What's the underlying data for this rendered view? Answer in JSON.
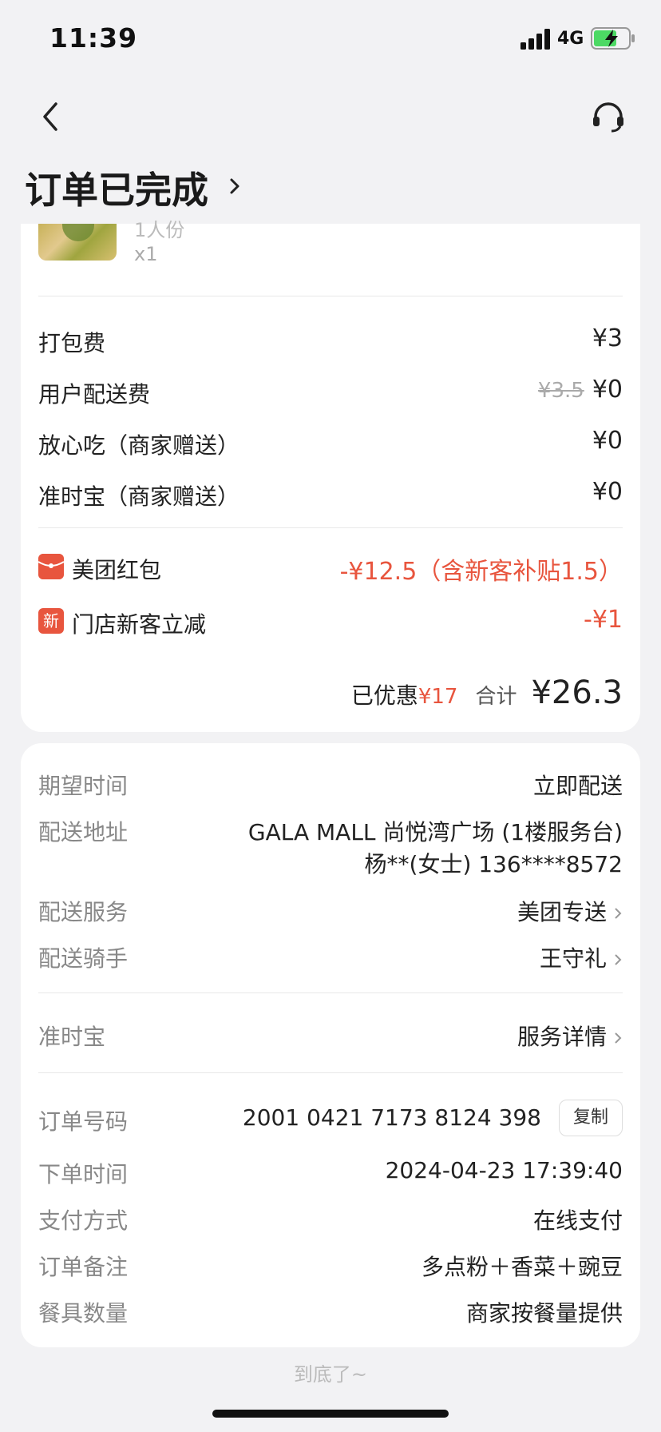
{
  "status": {
    "time": "11:39",
    "network": "4G"
  },
  "nav": {
    "title": "订单已完成"
  },
  "item": {
    "portion": "1人份",
    "qty": "x1"
  },
  "fees": [
    {
      "label": "打包费",
      "value": "¥3"
    },
    {
      "label": "用户配送费",
      "original": "¥3.5",
      "value": "¥0"
    },
    {
      "label": "放心吃（商家赠送）",
      "value": "¥0"
    },
    {
      "label": "准时宝（商家赠送）",
      "value": "¥0"
    }
  ],
  "discounts": [
    {
      "label": "美团红包",
      "value": "-¥12.5（含新客补贴1.5）"
    },
    {
      "label": "门店新客立减",
      "badge": "新",
      "value": "-¥1"
    }
  ],
  "summary": {
    "saved_label": "已优惠",
    "saved": "¥17",
    "total_label": "合计",
    "total": "¥26.3"
  },
  "delivery": {
    "expected_label": "期望时间",
    "expected": "立即配送",
    "address_label": "配送地址",
    "address_line1": "GALA MALL 尚悦湾广场 (1楼服务台)",
    "address_line2": "杨**(女士) 136****8572",
    "service_label": "配送服务",
    "service": "美团专送",
    "rider_label": "配送骑手",
    "rider": "王守礼",
    "ontime_label": "准时宝",
    "ontime": "服务详情"
  },
  "order": {
    "number_label": "订单号码",
    "number": "2001 0421 7173 8124 398",
    "copy": "复制",
    "time_label": "下单时间",
    "time": "2024-04-23 17:39:40",
    "pay_label": "支付方式",
    "pay": "在线支付",
    "note_label": "订单备注",
    "note": "多点粉＋香菜＋豌豆",
    "utensil_label": "餐具数量",
    "utensil": "商家按餐量提供"
  },
  "footer": "到底了~",
  "colors": {
    "accent": "#e8553e",
    "background": "#f2f2f4"
  }
}
